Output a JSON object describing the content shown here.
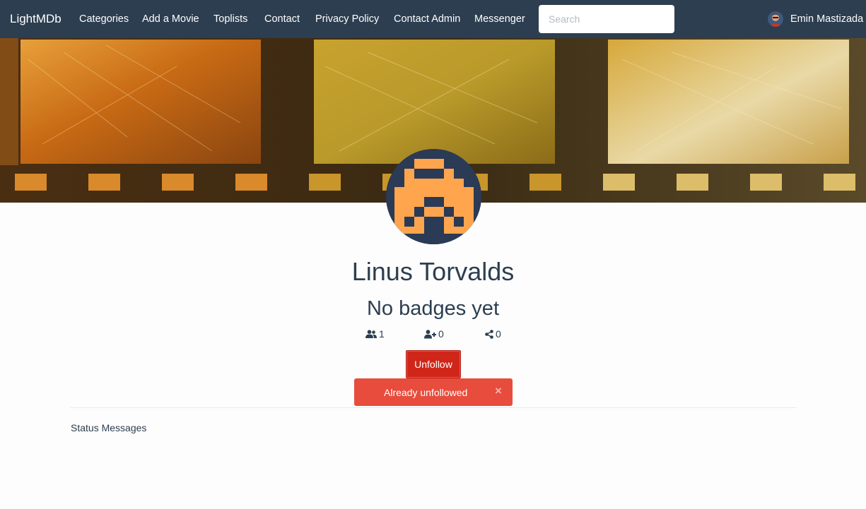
{
  "app": {
    "brand": "LightMDb",
    "colors": {
      "navbar": "#2c3e50",
      "unfollow": "#d0261a",
      "alert": "#e74c3c",
      "avatar_orange": "#ffa54d",
      "avatar_bg": "#2b3a55"
    }
  },
  "nav": {
    "items": [
      {
        "label": "Categories"
      },
      {
        "label": "Add a Movie"
      },
      {
        "label": "Toplists"
      },
      {
        "label": "Contact"
      },
      {
        "label": "Privacy Policy"
      },
      {
        "label": "Contact Admin"
      },
      {
        "label": "Messenger"
      }
    ],
    "search_placeholder": "Search",
    "user_name": "Emin Mastizada"
  },
  "profile": {
    "name": "Linus Torvalds",
    "badges": "No badges yet",
    "stats": [
      {
        "icon": "users-icon",
        "value": "1"
      },
      {
        "icon": "user-plus-icon",
        "value": "0"
      },
      {
        "icon": "share-icon",
        "value": "0"
      }
    ],
    "unfollow_label": "Unfollow"
  },
  "alert": {
    "message": "Already unfollowed",
    "close": "×"
  },
  "sections": {
    "status_messages": "Status Messages"
  }
}
